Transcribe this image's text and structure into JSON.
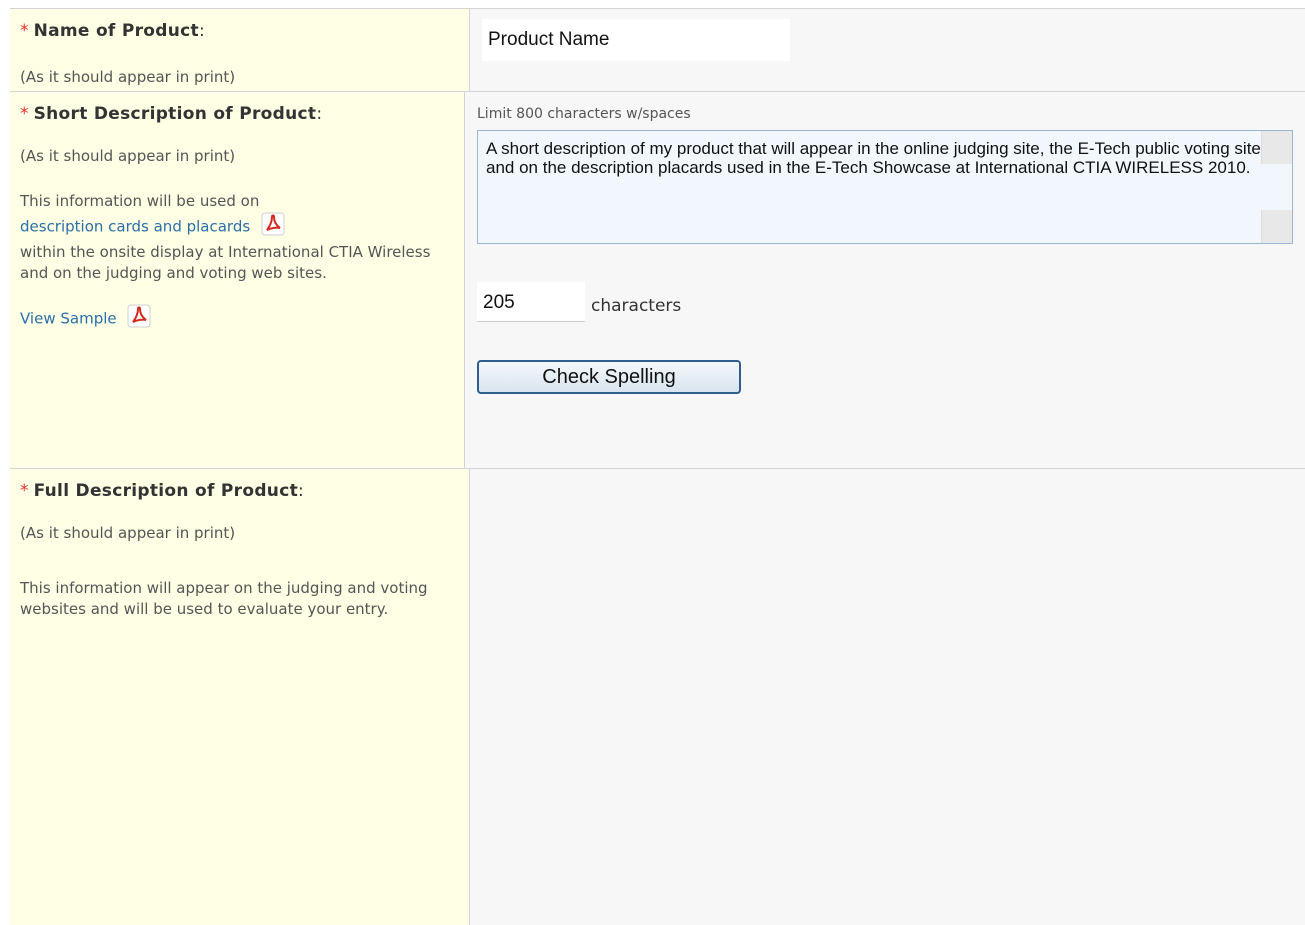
{
  "rows": [
    {
      "required_mark": "*",
      "title": "Name of Product",
      "colon": ":",
      "note": "(As it should appear in print)",
      "input_value": "Product Name"
    },
    {
      "required_mark": "*",
      "title": "Short Description of Product",
      "colon": ":",
      "note": "(As it should appear in print)",
      "info_text_pre": "This information will be used on",
      "info_link": "description cards and placards",
      "info_text_post": "within the onsite display at International CTIA Wireless and on the judging and voting web sites.",
      "sample_link": "View Sample",
      "limit_text": "Limit 800 characters w/spaces",
      "textarea_value": "A short description of my product that will appear in the online judging site, the E-Tech public voting site and on the description placards used in the E-Tech Showcase at International CTIA WIRELESS 2010.",
      "char_count": "205",
      "char_label": "characters",
      "spell_button": "Check Spelling"
    },
    {
      "required_mark": "*",
      "title": "Full Description of Product",
      "colon": ":",
      "note": "(As it should appear in print)",
      "info_text": "This information will appear on the judging and voting websites and will be used to evaluate your entry."
    }
  ],
  "colors": {
    "label_bg": "#ffffe6",
    "input_bg": "#f7f7f7",
    "required": "#e8322f",
    "link": "#2a6fa8"
  },
  "icons": [
    "pdf-icon",
    "pdf-icon"
  ]
}
